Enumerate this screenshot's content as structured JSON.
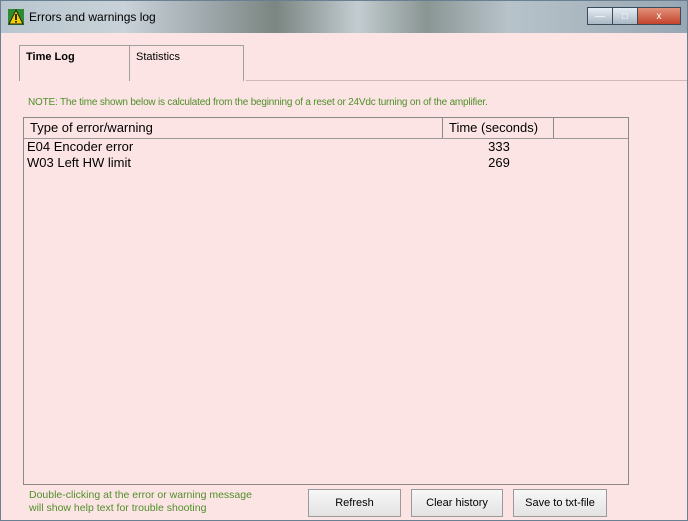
{
  "window": {
    "title": "Errors and warnings log",
    "minimize_glyph": "—",
    "maximize_glyph": "□",
    "close_glyph": "x"
  },
  "tabs": [
    {
      "label": "Time Log",
      "active": true
    },
    {
      "label": "Statistics",
      "active": false
    }
  ],
  "note": "NOTE: The time shown below is calculated from the beginning of a reset or 24Vdc turning on of the amplifier.",
  "table": {
    "columns": [
      "Type of error/warning",
      "Time (seconds)"
    ],
    "rows": [
      {
        "type": "E04 Encoder error",
        "time": "333"
      },
      {
        "type": "W03 Left HW limit",
        "time": "269"
      }
    ]
  },
  "footer": {
    "hint_line1": "Double-clicking at the error or warning message",
    "hint_line2": "will show help text for trouble shooting",
    "refresh_label": "Refresh",
    "clear_label": "Clear history",
    "save_label": "Save to txt-file"
  },
  "colors": {
    "background": "#fde4e4",
    "note_text": "#4f8f2a",
    "icon_bg": "#2e8b2e",
    "warning_icon": "#f5d000"
  },
  "icons": [
    "warning-icon",
    "minimize-icon",
    "maximize-icon",
    "close-icon"
  ]
}
